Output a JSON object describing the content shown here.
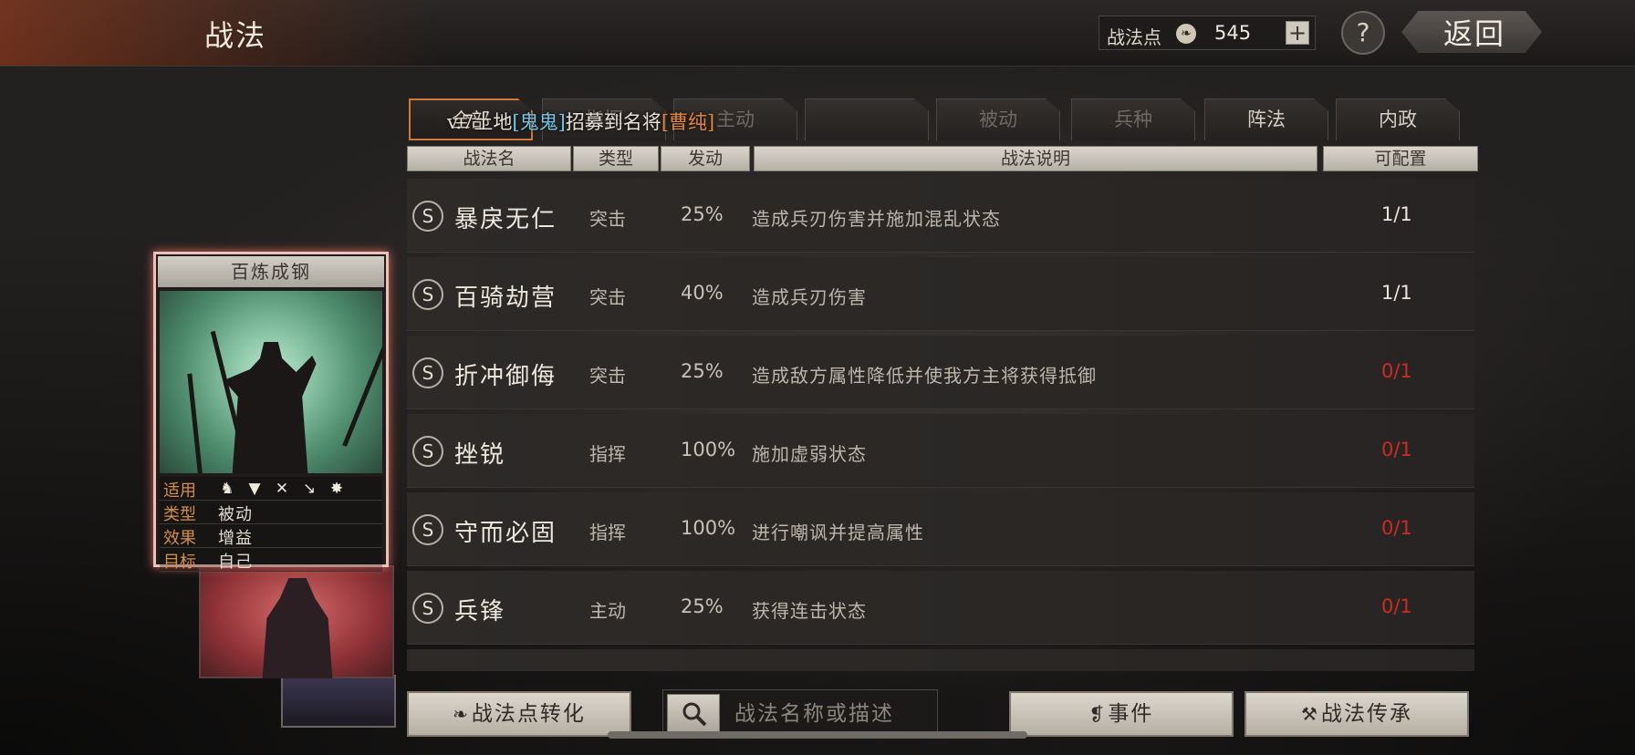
{
  "header": {
    "title": "战法",
    "points_label": "战法点",
    "points_icon": "flame-coin-icon",
    "points_value": "545",
    "plus_label": "+",
    "help_label": "?",
    "back_label": "返回"
  },
  "tabs": [
    {
      "label": "全部",
      "active": true
    },
    {
      "label": "指挥",
      "active": false
    },
    {
      "label": "主动",
      "active": false
    },
    {
      "label": "",
      "active": false
    },
    {
      "label": "被动",
      "active": false
    },
    {
      "label": "兵种",
      "active": false
    },
    {
      "label": "阵法",
      "active": false
    },
    {
      "label": "内政",
      "active": false
    }
  ],
  "ticker": {
    "prefix": "v.7土地",
    "player": "[鬼鬼]",
    "middle": "招募到名将",
    "general": "[曹纯]"
  },
  "table": {
    "headers": [
      "战法名",
      "类型",
      "发动",
      "战法说明",
      "可配置"
    ],
    "rows": [
      {
        "grade": "S",
        "name": "暴戾无仁",
        "type": "突击",
        "rate": "25%",
        "desc": "造成兵刃伤害并施加混乱状态",
        "config": "1/1",
        "available": true
      },
      {
        "grade": "S",
        "name": "百骑劫营",
        "type": "突击",
        "rate": "40%",
        "desc": "造成兵刃伤害",
        "config": "1/1",
        "available": true
      },
      {
        "grade": "S",
        "name": "折冲御侮",
        "type": "突击",
        "rate": "25%",
        "desc": "造成敌方属性降低并使我方主将获得抵御",
        "config": "0/1",
        "available": false
      },
      {
        "grade": "S",
        "name": "挫锐",
        "type": "指挥",
        "rate": "100%",
        "desc": "施加虚弱状态",
        "config": "0/1",
        "available": false
      },
      {
        "grade": "S",
        "name": "守而必固",
        "type": "指挥",
        "rate": "100%",
        "desc": "进行嘲讽并提高属性",
        "config": "0/1",
        "available": false
      },
      {
        "grade": "S",
        "name": "兵锋",
        "type": "主动",
        "rate": "25%",
        "desc": "获得连击状态",
        "config": "0/1",
        "available": false
      }
    ]
  },
  "card": {
    "title": "百炼成钢",
    "stats": [
      {
        "key": "适用",
        "icons": [
          "cavalry-icon",
          "shield-icon",
          "bow-icon",
          "spear-icon",
          "wheel-icon"
        ]
      },
      {
        "key": "类型",
        "value": "被动"
      },
      {
        "key": "效果",
        "value": "增益"
      },
      {
        "key": "目标",
        "value": "自己"
      }
    ]
  },
  "bottom": {
    "convert_label": "战法点转化",
    "search_placeholder": "战法名称或描述",
    "events_label": "事件",
    "inherit_label": "战法传承"
  },
  "colors": {
    "accent_orange": "#d2773a",
    "unavailable_red": "#cc2c22",
    "ticker_blue": "#6fc6e6"
  }
}
